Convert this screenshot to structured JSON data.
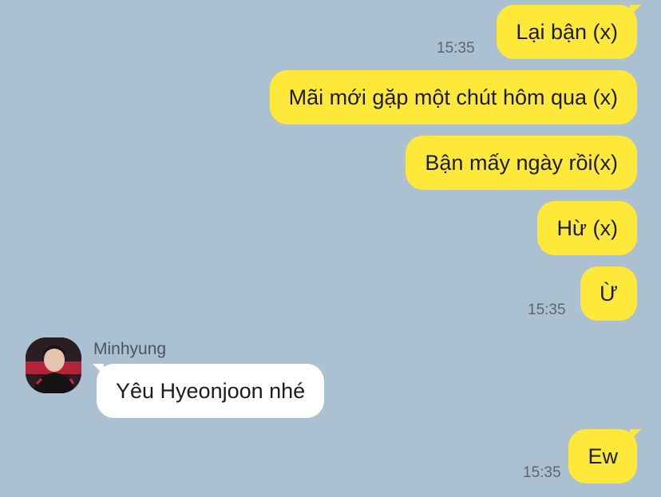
{
  "messages": [
    {
      "text": "Lại bận (x)",
      "time": "15:35"
    },
    {
      "text": "Mãi mới gặp một chút hôm qua (x)"
    },
    {
      "text": "Bận mấy ngày rồi(x)"
    },
    {
      "text": "Hừ (x)"
    },
    {
      "text": "Ừ",
      "time": "15:35"
    },
    {
      "sender": "Minhyung",
      "text": "Yêu Hyeonjoon nhé"
    },
    {
      "text": "Ew",
      "time": "15:35"
    }
  ],
  "colors": {
    "background": "#abc1d1",
    "outgoing_bubble": "#fee93b",
    "incoming_bubble": "#ffffff"
  }
}
